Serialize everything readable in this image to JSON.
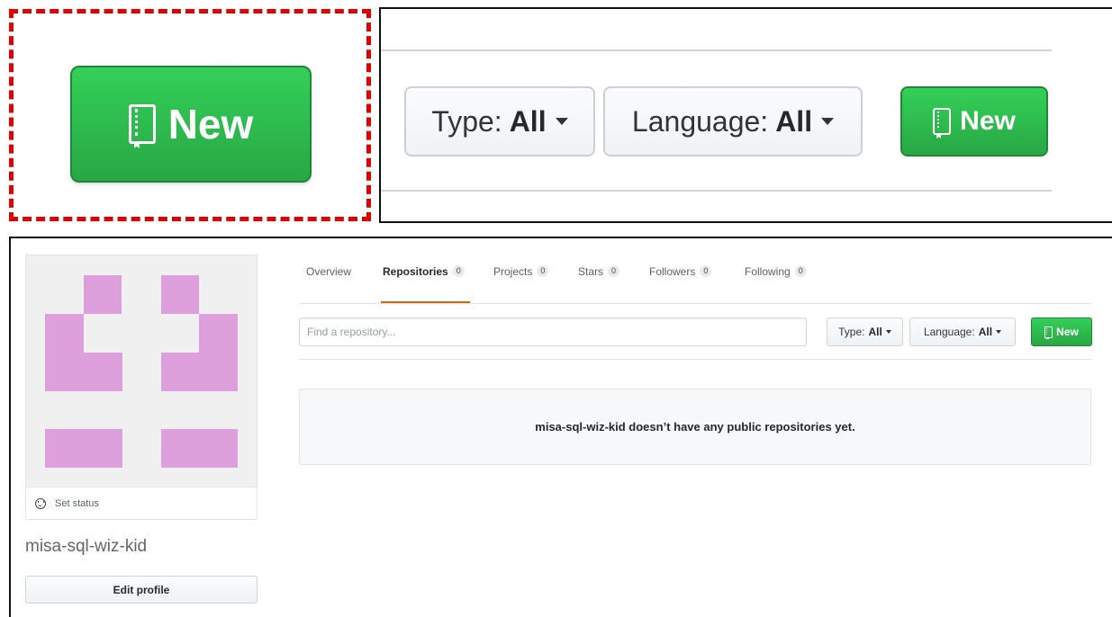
{
  "callouts": {
    "left": {
      "new_label": "New"
    },
    "right": {
      "type_prefix": "Type:",
      "type_value": "All",
      "language_prefix": "Language:",
      "language_value": "All",
      "new_label": "New"
    }
  },
  "profile": {
    "set_status_label": "Set status",
    "username": "misa-sql-wiz-kid",
    "edit_profile_label": "Edit profile",
    "avatar_color": "#dda0dd"
  },
  "tabs": [
    {
      "label": "Overview",
      "count": null
    },
    {
      "label": "Repositories",
      "count": "0",
      "active": true
    },
    {
      "label": "Projects",
      "count": "0"
    },
    {
      "label": "Stars",
      "count": "0"
    },
    {
      "label": "Followers",
      "count": "0"
    },
    {
      "label": "Following",
      "count": "0"
    }
  ],
  "filters": {
    "search_placeholder": "Find a repository...",
    "type_prefix": "Type:",
    "type_value": "All",
    "language_prefix": "Language:",
    "language_value": "All",
    "new_label": "New"
  },
  "blankslate": {
    "message": "misa-sql-wiz-kid doesn’t have any public repositories yet."
  },
  "colors": {
    "new_button": "#28a745",
    "active_tab_underline": "#e36209",
    "callout_border": "#e00000"
  }
}
